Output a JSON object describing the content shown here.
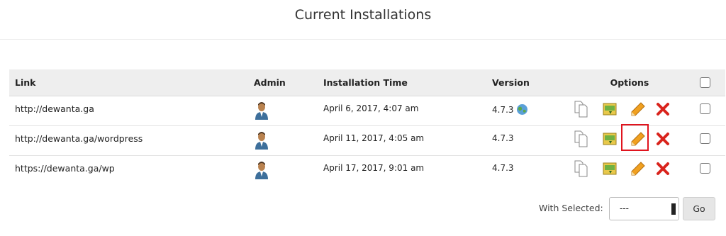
{
  "page": {
    "title": "Current Installations"
  },
  "table": {
    "headers": {
      "link": "Link",
      "admin": "Admin",
      "time": "Installation Time",
      "version": "Version",
      "options": "Options"
    },
    "rows": [
      {
        "link": "http://dewanta.ga",
        "time": "April 6, 2017, 4:07 am",
        "version": "4.7.3",
        "upgrade_icon": "globe-icon",
        "highlight_edit": false
      },
      {
        "link": "http://dewanta.ga/wordpress",
        "time": "April 11, 2017, 4:05 am",
        "version": "4.7.3",
        "upgrade_icon": null,
        "highlight_edit": true
      },
      {
        "link": "https://dewanta.ga/wp",
        "time": "April 17, 2017, 9:01 am",
        "version": "4.7.3",
        "upgrade_icon": null,
        "highlight_edit": false
      }
    ]
  },
  "footer": {
    "with_selected_label": "With Selected:",
    "select_value": "---",
    "go_label": "Go"
  },
  "colors": {
    "highlight": "#e0141e",
    "remove": "#d9231c",
    "edit": "#f0a020"
  }
}
